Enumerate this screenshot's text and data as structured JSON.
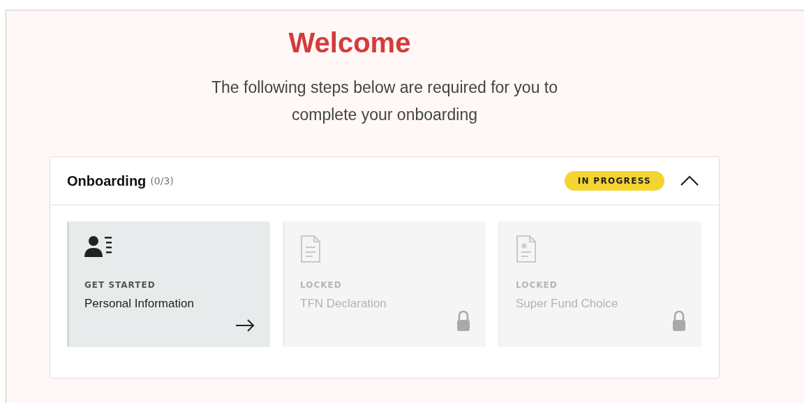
{
  "title": "Welcome",
  "subtitle": "The following steps below are required for you to complete your onboarding",
  "section": {
    "title": "Onboarding",
    "count": "(0/3)",
    "status": "IN PROGRESS",
    "expanded": true,
    "steps": [
      {
        "kind": "person",
        "state": "GET STARTED",
        "label": "Personal Information",
        "locked": false
      },
      {
        "kind": "document",
        "state": "LOCKED",
        "label": "TFN Declaration",
        "locked": true
      },
      {
        "kind": "starred-document",
        "state": "LOCKED",
        "label": "Super Fund Choice",
        "locked": true
      }
    ]
  }
}
